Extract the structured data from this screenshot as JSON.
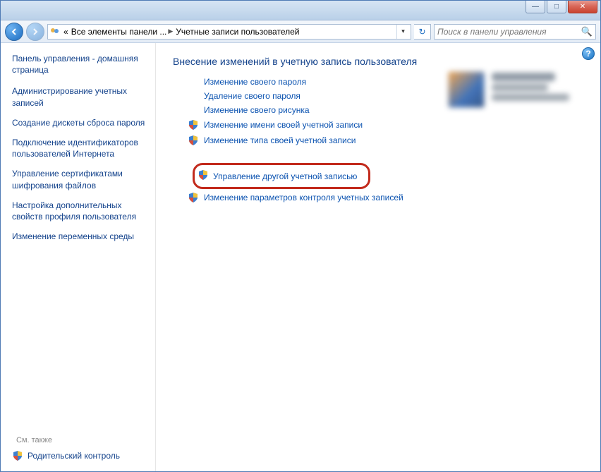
{
  "window": {
    "min_label": "—",
    "max_label": "□",
    "close_label": "✕"
  },
  "breadcrumb": {
    "prefix": "«",
    "item1": "Все элементы панели ...",
    "item2": "Учетные записи пользователей"
  },
  "search": {
    "placeholder": "Поиск в панели управления"
  },
  "sidebar": {
    "home": "Панель управления - домашняя страница",
    "items": [
      "Администрирование учетных записей",
      "Создание дискеты сброса пароля",
      "Подключение идентификаторов пользователей Интернета",
      "Управление сертификатами шифрования файлов",
      "Настройка дополнительных свойств профиля пользователя",
      "Изменение переменных среды"
    ],
    "see_also": "См. также",
    "footer": "Родительский контроль"
  },
  "main": {
    "title": "Внесение изменений в учетную запись пользователя",
    "tasks_simple": [
      "Изменение своего пароля",
      "Удаление своего пароля",
      "Изменение своего рисунка"
    ],
    "tasks_shield": [
      "Изменение имени своей учетной записи",
      "Изменение типа своей учетной записи"
    ],
    "task_highlighted": "Управление другой учетной записью",
    "task_after": "Изменение параметров контроля учетных записей"
  }
}
